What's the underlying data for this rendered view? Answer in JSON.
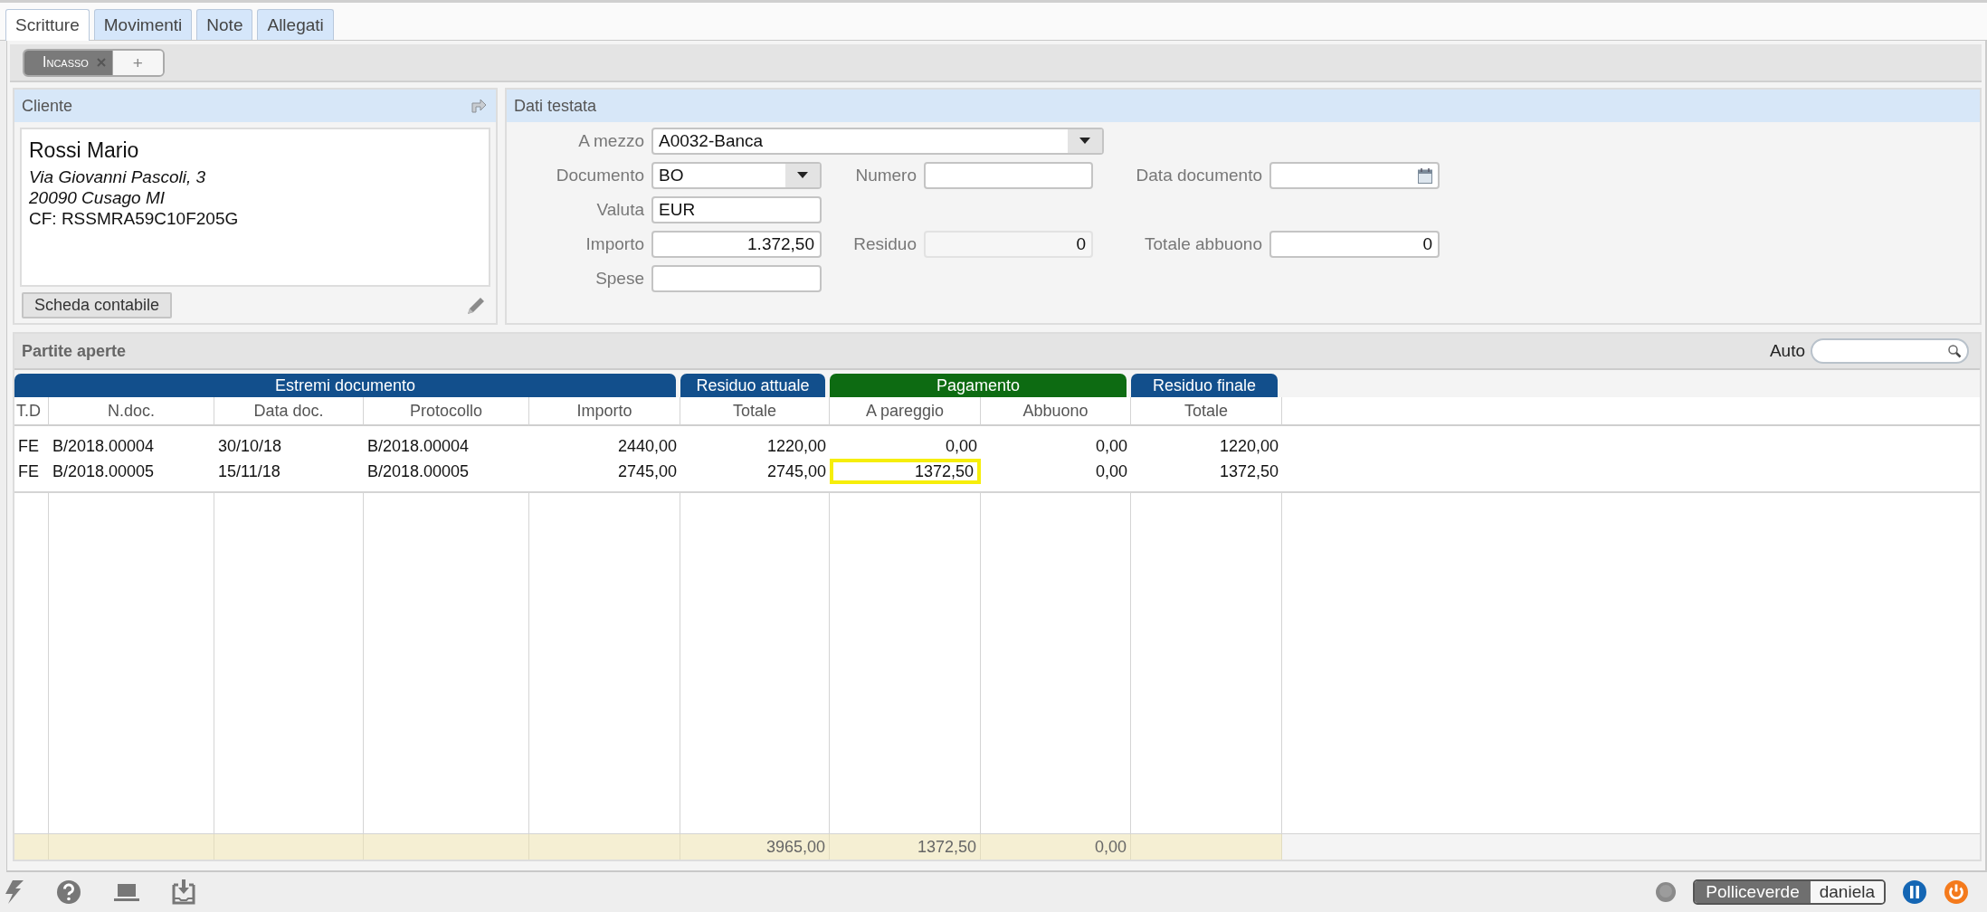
{
  "tabs": [
    {
      "label": "Scritture",
      "selected": true
    },
    {
      "label": "Movimenti",
      "selected": false
    },
    {
      "label": "Note",
      "selected": false
    },
    {
      "label": "Allegati",
      "selected": false
    }
  ],
  "subtabs": {
    "items": [
      {
        "label": "Incasso",
        "selected": true,
        "closable": true
      }
    ],
    "add_label": "+"
  },
  "cliente": {
    "title": "Cliente",
    "name": "Rossi Mario",
    "address_lines": [
      "Via Giovanni Pascoli, 3",
      "20090 Cusago  MI"
    ],
    "cf": "CF: RSSMRA59C10F205G",
    "button": "Scheda contabile"
  },
  "dati_testata": {
    "title": "Dati testata",
    "rows": [
      [
        {
          "label": "A mezzo",
          "value": "A0032-Banca",
          "kind": "select",
          "wide": true,
          "disabled": false
        }
      ],
      [
        {
          "label": "Documento",
          "value": "BO",
          "kind": "select",
          "wide": false,
          "disabled": false
        },
        {
          "label": "Numero",
          "kind": "text",
          "wide": false,
          "disabled": false
        },
        {
          "label": "Data documento",
          "kind": "date",
          "wide": false,
          "disabled": false
        }
      ],
      [
        {
          "label": "Valuta",
          "value": "EUR",
          "kind": "text",
          "wide": false,
          "disabled": false
        }
      ],
      [
        {
          "label": "Importo",
          "value": "1.372,50",
          "kind": "number",
          "wide": false,
          "disabled": false
        },
        {
          "label": "Residuo",
          "value": "0",
          "kind": "number",
          "wide": false,
          "disabled": true
        },
        {
          "label": "Totale abbuono",
          "value": "0",
          "kind": "number",
          "wide": false,
          "disabled": false
        }
      ],
      [
        {
          "label": "Spese",
          "kind": "text",
          "wide": false,
          "disabled": false
        }
      ]
    ]
  },
  "partite": {
    "title": "Partite aperte",
    "filter_label": "Auto",
    "groups": [
      {
        "label": "Estremi documento",
        "color": "#124f8c",
        "columns": [
          {
            "label": "T.D"
          },
          {
            "label": "N.doc."
          },
          {
            "label": "Data doc."
          },
          {
            "label": "Protocollo"
          },
          {
            "label": "Importo"
          }
        ]
      },
      {
        "label": "Residuo attuale",
        "color": "#124f8c",
        "columns": [
          {
            "label": "Totale",
            "total": "3965,00"
          }
        ]
      },
      {
        "label": "Pagamento",
        "color": "#0d6b12",
        "columns": [
          {
            "label": "A pareggio",
            "total": "1372,50"
          },
          {
            "label": "Abbuono",
            "total": "0,00"
          }
        ]
      },
      {
        "label": "Residuo finale",
        "color": "#124f8c",
        "columns": [
          {
            "label": "Totale"
          }
        ]
      }
    ],
    "rows": [
      {
        "cells": [
          "FE",
          "B/2018.00004",
          "30/10/18",
          "B/2018.00004",
          "2440,00",
          "1220,00",
          "0,00",
          "0,00",
          "1220,00"
        ],
        "focused": false
      },
      {
        "cells": [
          "FE",
          "B/2018.00005",
          "15/11/18",
          "B/2018.00005",
          "2745,00",
          "2745,00",
          "1372,50",
          "0,00",
          "1372,50"
        ],
        "focused": true
      }
    ]
  },
  "status_bar": {
    "company": "Polliceverde",
    "user": "daniela"
  }
}
